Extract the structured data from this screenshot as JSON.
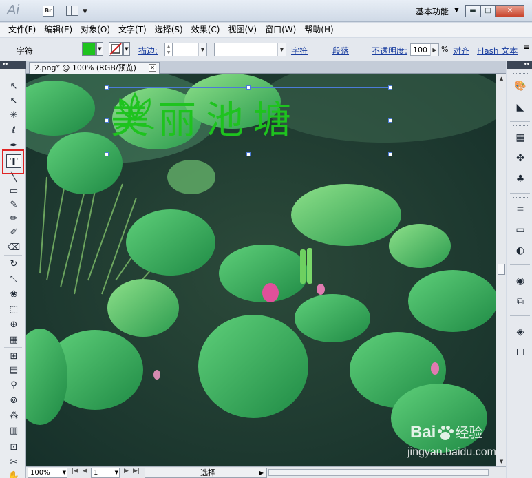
{
  "titlebar": {
    "app_logo": "Ai",
    "bridge_label": "Br",
    "workspace": "基本功能",
    "minimize": "▬",
    "maximize": "□",
    "close": "✕"
  },
  "menubar": {
    "items": [
      "文件(F)",
      "编辑(E)",
      "对象(O)",
      "文字(T)",
      "选择(S)",
      "效果(C)",
      "视图(V)",
      "窗口(W)",
      "帮助(H)"
    ]
  },
  "controlbar": {
    "mode_label": "字符",
    "fill_color": "#1ec31e",
    "stroke_label": "描边:",
    "char_link": "字符",
    "para_link": "段落",
    "opacity_label": "不透明度:",
    "opacity_value": "100",
    "opacity_unit": "%",
    "align_link": "对齐",
    "flash_link": "Flash 文本"
  },
  "document": {
    "tab_title": "2.png* @ 100% (RGB/预览)",
    "text_part1": "美丽",
    "text_part2": "池塘",
    "text_color": "#1ec31e"
  },
  "tools": [
    {
      "name": "selection-tool",
      "glyph": "↖"
    },
    {
      "name": "direct-selection-tool",
      "glyph": "↖"
    },
    {
      "name": "magic-wand-tool",
      "glyph": "✳"
    },
    {
      "name": "lasso-tool",
      "glyph": "ℓ"
    },
    {
      "name": "pen-tool",
      "glyph": "✒"
    },
    {
      "name": "type-tool",
      "glyph": "T"
    },
    {
      "name": "line-tool",
      "glyph": "╲"
    },
    {
      "name": "rectangle-tool",
      "glyph": "▭"
    },
    {
      "name": "paintbrush-tool",
      "glyph": "✎"
    },
    {
      "name": "pencil-tool",
      "glyph": "✏"
    },
    {
      "name": "blob-brush-tool",
      "glyph": "✐"
    },
    {
      "name": "eraser-tool",
      "glyph": "⌫"
    },
    {
      "name": "rotate-tool",
      "glyph": "↻"
    },
    {
      "name": "scale-tool",
      "glyph": "⤡"
    },
    {
      "name": "warp-tool",
      "glyph": "❀"
    },
    {
      "name": "free-transform-tool",
      "glyph": "⬚"
    },
    {
      "name": "shape-builder-tool",
      "glyph": "⊕"
    },
    {
      "name": "graph-tool",
      "glyph": "▦"
    },
    {
      "name": "mesh-tool",
      "glyph": "⊞"
    },
    {
      "name": "gradient-tool",
      "glyph": "▤"
    },
    {
      "name": "eyedropper-tool",
      "glyph": "⚲"
    },
    {
      "name": "blend-tool",
      "glyph": "⊚"
    },
    {
      "name": "symbol-sprayer-tool",
      "glyph": "⁂"
    },
    {
      "name": "column-graph-tool",
      "glyph": "▥"
    },
    {
      "name": "artboard-tool",
      "glyph": "⊡"
    },
    {
      "name": "slice-tool",
      "glyph": "✂"
    },
    {
      "name": "hand-tool",
      "glyph": "✋"
    }
  ],
  "right_panels": [
    {
      "name": "color-panel-icon",
      "glyph": "🎨"
    },
    {
      "name": "color-guide-panel-icon",
      "glyph": "◣"
    },
    {
      "name": "swatches-panel-icon",
      "glyph": "▦"
    },
    {
      "name": "brushes-panel-icon",
      "glyph": "✤"
    },
    {
      "name": "symbols-panel-icon",
      "glyph": "♣"
    },
    {
      "name": "stroke-panel-icon",
      "glyph": "≡"
    },
    {
      "name": "gradient-panel-icon",
      "glyph": "▭"
    },
    {
      "name": "transparency-panel-icon",
      "glyph": "◐"
    },
    {
      "name": "appearance-panel-icon",
      "glyph": "◉"
    },
    {
      "name": "graphic-styles-panel-icon",
      "glyph": "⧉"
    },
    {
      "name": "layers-panel-icon",
      "glyph": "◈"
    },
    {
      "name": "artboards-panel-icon",
      "glyph": "⧠"
    }
  ],
  "statusbar": {
    "zoom": "100%",
    "page": "1",
    "status_text": "选择"
  },
  "watermark": {
    "brand": "Bai",
    "brand_cn": "经验",
    "url": "jingyan.baidu.com"
  }
}
